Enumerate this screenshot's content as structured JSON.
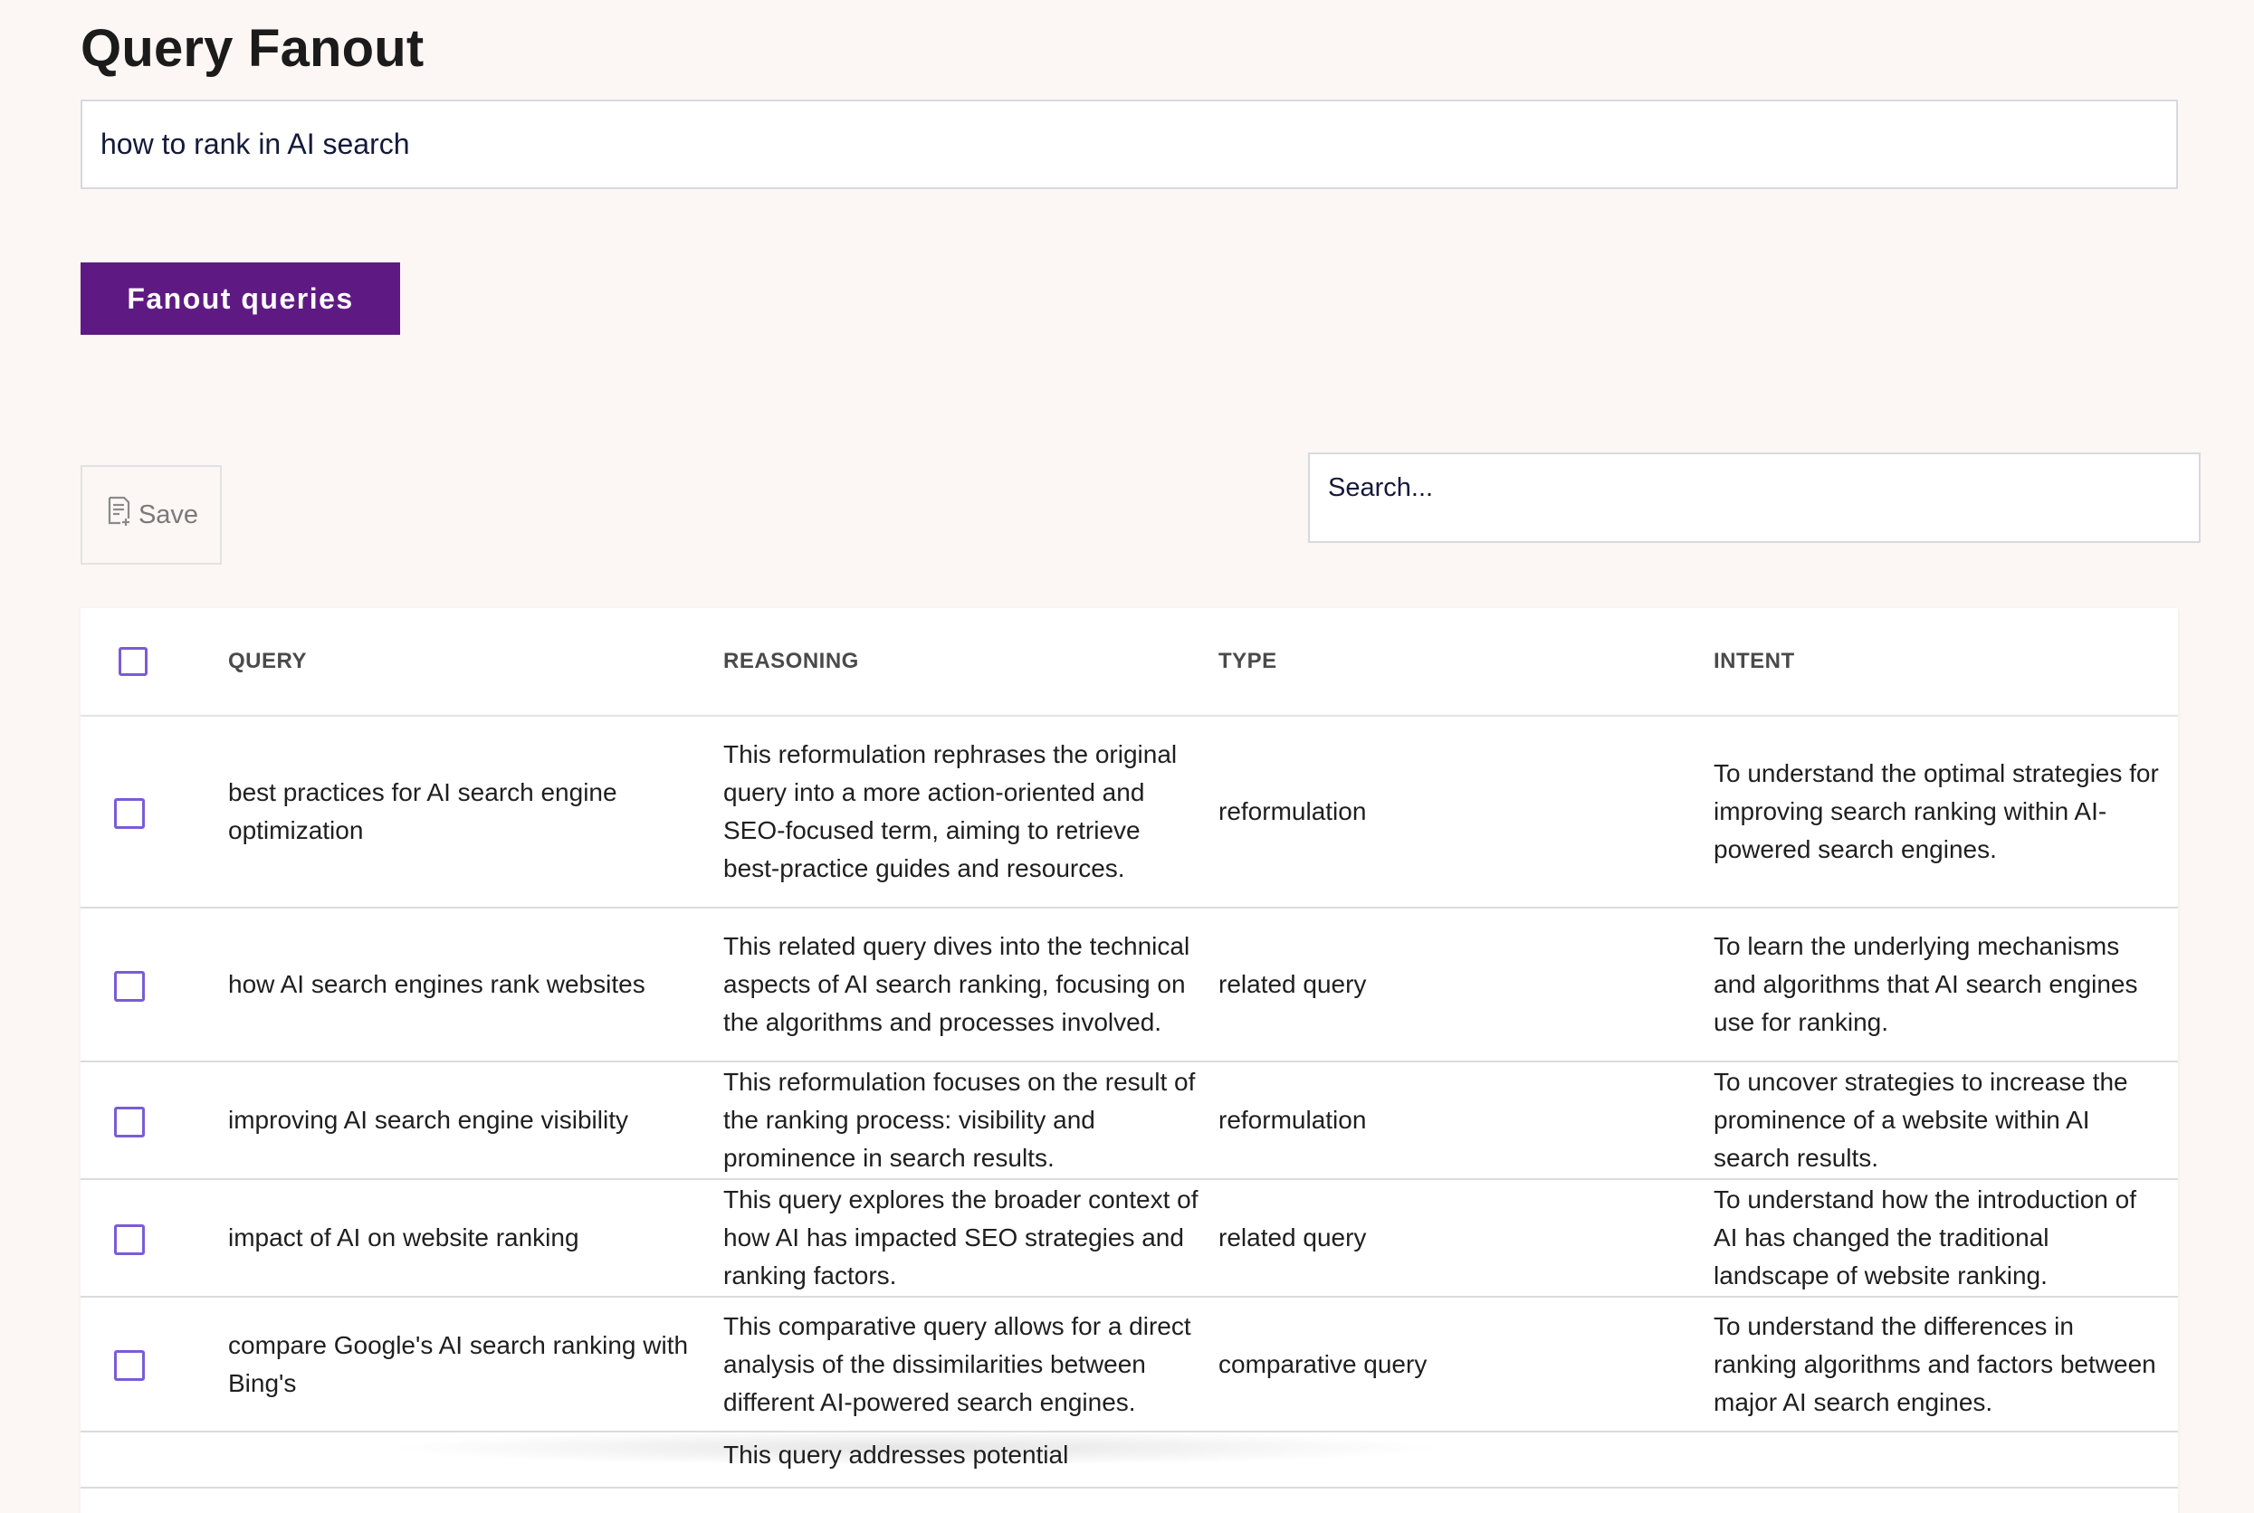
{
  "page": {
    "title": "Query Fanout"
  },
  "query_input": {
    "value": "how to rank in AI search"
  },
  "fanout_button": {
    "label": "Fanout queries"
  },
  "toolbar": {
    "save_label": "Save",
    "search_placeholder": "Search..."
  },
  "colors": {
    "accent": "#5e1a82",
    "checkbox": "#7a5cd6",
    "background": "#fcf7f4"
  },
  "table": {
    "headers": {
      "query": "QUERY",
      "reasoning": "REASONING",
      "type": "TYPE",
      "intent": "INTENT"
    },
    "rows": [
      {
        "query": "best practices for AI search engine optimization",
        "reasoning": "This reformulation rephrases the original query into a more action-oriented and SEO-focused term, aiming to retrieve best-practice guides and resources.",
        "type": "reformulation",
        "intent": "To understand the optimal strategies for improving search ranking within AI-powered search engines."
      },
      {
        "query": "how AI search engines rank websites",
        "reasoning": "This related query dives into the technical aspects of AI search ranking, focusing on the algorithms and processes involved.",
        "type": "related query",
        "intent": "To learn the underlying mechanisms and algorithms that AI search engines use for ranking."
      },
      {
        "query": "improving AI search engine visibility",
        "reasoning": "This reformulation focuses on the result of the ranking process: visibility and prominence in search results.",
        "type": "reformulation",
        "intent": "To uncover strategies to increase the prominence of a website within AI search results."
      },
      {
        "query": "impact of AI on website ranking",
        "reasoning": "This query explores the broader context of how AI has impacted SEO strategies and ranking factors.",
        "type": "related query",
        "intent": "To understand how the introduction of AI has changed the traditional landscape of website ranking."
      },
      {
        "query": "compare Google's AI search ranking with Bing's",
        "reasoning": "This comparative query allows for a direct analysis of the dissimilarities between different AI-powered search engines.",
        "type": "comparative query",
        "intent": "To understand the differences in ranking algorithms and factors between major AI search engines."
      },
      {
        "query": "",
        "reasoning": "This query addresses potential",
        "type": "",
        "intent": ""
      }
    ]
  }
}
